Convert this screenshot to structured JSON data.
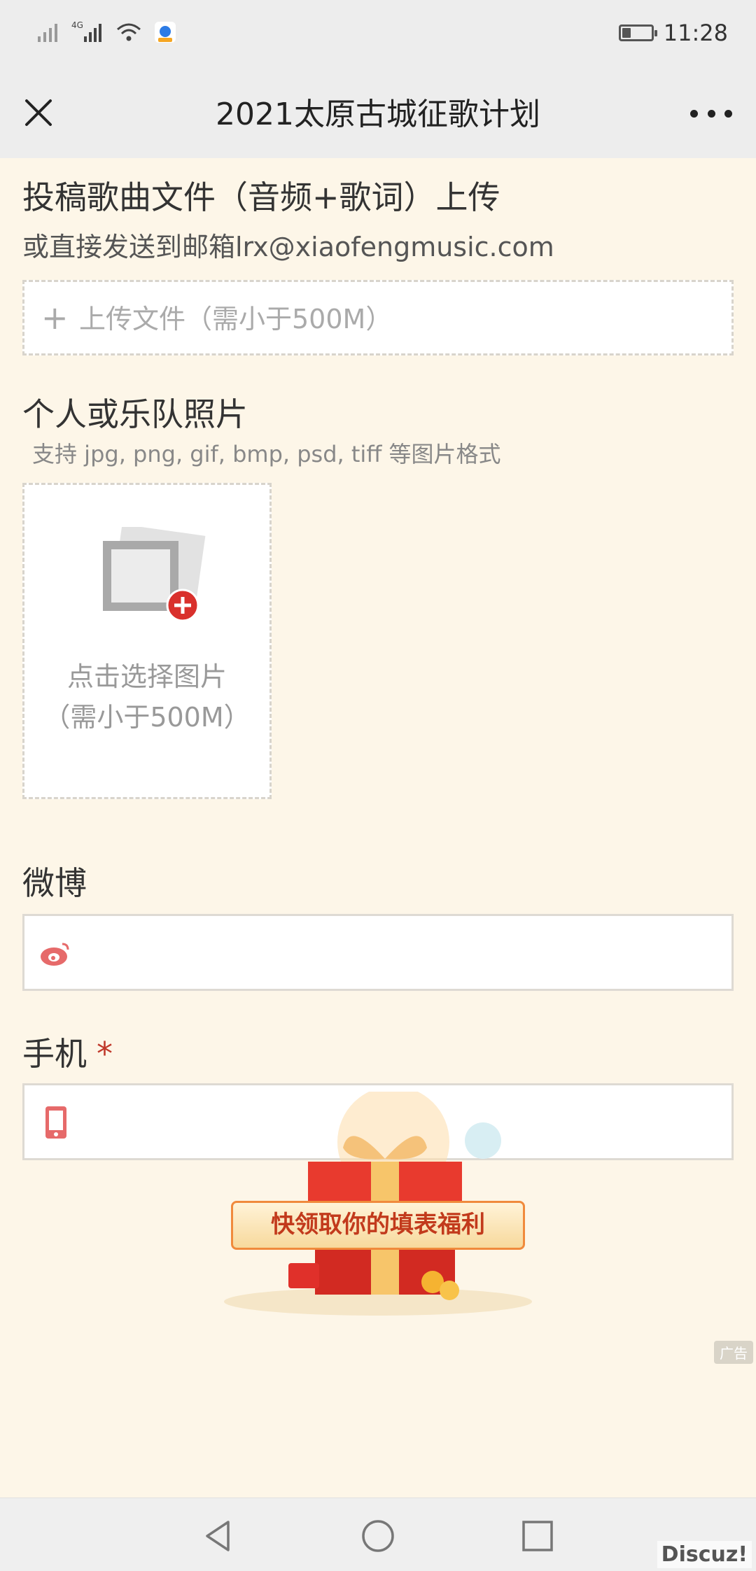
{
  "status_bar": {
    "time": "11:28",
    "battery_level": 0.3
  },
  "nav": {
    "title": "2021太原古城征歌计划"
  },
  "upload_section": {
    "title": "投稿歌曲文件（音频+歌词）上传",
    "subtitle": "或直接发送到邮箱lrx@xiaofengmusic.com",
    "button_label": "上传文件（需小于500M）"
  },
  "photo_section": {
    "title": "个人或乐队照片",
    "hint": "支持 jpg, png, gif, bmp, psd, tiff 等图片格式",
    "picker_line1": "点击选择图片",
    "picker_line2": "（需小于500M）"
  },
  "weibo": {
    "label": "微博",
    "value": ""
  },
  "phone": {
    "label": "手机",
    "required_mark": "*",
    "value": ""
  },
  "ad": {
    "banner_text": "快领取你的填表福利",
    "tag": "广告"
  },
  "watermark": "Discuz!"
}
